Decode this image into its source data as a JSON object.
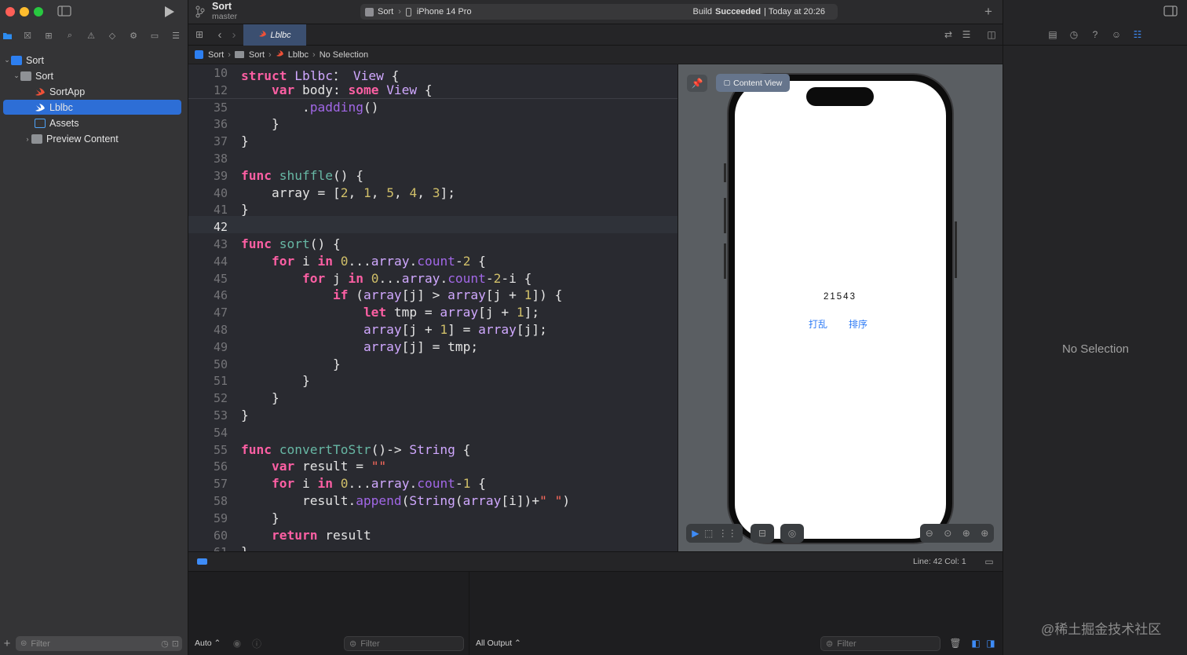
{
  "window": {
    "project_title": "Sort",
    "branch": "master",
    "scheme": "Sort",
    "device": "iPhone 14 Pro",
    "build_status_prefix": "Build",
    "build_status_word": "Succeeded",
    "build_status_suffix": "| Today at 20:26"
  },
  "navigator": {
    "items": [
      {
        "label": "Sort",
        "icon": "project-icon"
      },
      {
        "label": "Sort",
        "icon": "folder-icon"
      },
      {
        "label": "SortApp",
        "icon": "swift-icon"
      },
      {
        "label": "Lblbc",
        "icon": "swift-icon"
      },
      {
        "label": "Assets",
        "icon": "asset-catalog-icon"
      },
      {
        "label": "Preview Content",
        "icon": "folder-icon"
      }
    ],
    "filter_placeholder": "Filter"
  },
  "editor": {
    "active_tab": "Lblbc",
    "breadcrumb": [
      "Sort",
      "Sort",
      "Lblbc",
      "No Selection"
    ],
    "current_line": "42",
    "lines": [
      {
        "n": "10",
        "segs": [
          [
            "kw",
            "struct "
          ],
          [
            "ty",
            "Lblbc"
          ],
          [
            "",
            "："
          ],
          [
            "ty",
            " View"
          ],
          [
            "",
            " {"
          ]
        ]
      },
      {
        "n": "12",
        "segs": [
          [
            "",
            "    "
          ],
          [
            "kw",
            "var "
          ],
          [
            "",
            "body: "
          ],
          [
            "kw",
            "some "
          ],
          [
            "ty",
            "View"
          ],
          [
            "",
            " {"
          ]
        ]
      },
      {
        "n": "35",
        "segs": [
          [
            "",
            "        ."
          ],
          [
            "mt",
            "padding"
          ],
          [
            "",
            "()"
          ]
        ]
      },
      {
        "n": "36",
        "segs": [
          [
            "",
            "    }"
          ]
        ]
      },
      {
        "n": "37",
        "segs": [
          [
            "",
            "}"
          ]
        ]
      },
      {
        "n": "38",
        "segs": [
          [
            "",
            ""
          ]
        ]
      },
      {
        "n": "39",
        "segs": [
          [
            "kw",
            "func "
          ],
          [
            "fn",
            "shuffle"
          ],
          [
            "",
            "() {"
          ]
        ]
      },
      {
        "n": "40",
        "segs": [
          [
            "",
            "    array = ["
          ],
          [
            "nu",
            "2"
          ],
          [
            "",
            ", "
          ],
          [
            "nu",
            "1"
          ],
          [
            "",
            ", "
          ],
          [
            "nu",
            "5"
          ],
          [
            "",
            ", "
          ],
          [
            "nu",
            "4"
          ],
          [
            "",
            ", "
          ],
          [
            "nu",
            "3"
          ],
          [
            "",
            "];"
          ]
        ]
      },
      {
        "n": "41",
        "segs": [
          [
            "",
            "}"
          ]
        ]
      },
      {
        "n": "42",
        "segs": [
          [
            "",
            ""
          ]
        ]
      },
      {
        "n": "43",
        "segs": [
          [
            "kw",
            "func "
          ],
          [
            "fn",
            "sort"
          ],
          [
            "",
            "() {"
          ]
        ]
      },
      {
        "n": "44",
        "segs": [
          [
            "",
            "    "
          ],
          [
            "kw",
            "for "
          ],
          [
            "",
            "i "
          ],
          [
            "kw",
            "in "
          ],
          [
            "nu",
            "0"
          ],
          [
            "",
            "..."
          ],
          [
            "ty",
            "array"
          ],
          [
            "",
            "."
          ],
          [
            "mt",
            "count"
          ],
          [
            "",
            "-"
          ],
          [
            "nu",
            "2"
          ],
          [
            "",
            " {"
          ]
        ]
      },
      {
        "n": "45",
        "segs": [
          [
            "",
            "        "
          ],
          [
            "kw",
            "for "
          ],
          [
            "",
            "j "
          ],
          [
            "kw",
            "in "
          ],
          [
            "nu",
            "0"
          ],
          [
            "",
            "..."
          ],
          [
            "ty",
            "array"
          ],
          [
            "",
            "."
          ],
          [
            "mt",
            "count"
          ],
          [
            "",
            "-"
          ],
          [
            "nu",
            "2"
          ],
          [
            "",
            "-i {"
          ]
        ]
      },
      {
        "n": "46",
        "segs": [
          [
            "",
            "            "
          ],
          [
            "kw",
            "if "
          ],
          [
            "",
            "("
          ],
          [
            "ty",
            "array"
          ],
          [
            "",
            "[j] > "
          ],
          [
            "ty",
            "array"
          ],
          [
            "",
            "[j + "
          ],
          [
            "nu",
            "1"
          ],
          [
            "",
            "]) {"
          ]
        ]
      },
      {
        "n": "47",
        "segs": [
          [
            "",
            "                "
          ],
          [
            "kw",
            "let "
          ],
          [
            "",
            "tmp = "
          ],
          [
            "ty",
            "array"
          ],
          [
            "",
            "[j + "
          ],
          [
            "nu",
            "1"
          ],
          [
            "",
            "];"
          ]
        ]
      },
      {
        "n": "48",
        "segs": [
          [
            "",
            "                "
          ],
          [
            "ty",
            "array"
          ],
          [
            "",
            "[j + "
          ],
          [
            "nu",
            "1"
          ],
          [
            "",
            "] = "
          ],
          [
            "ty",
            "array"
          ],
          [
            "",
            "[j];"
          ]
        ]
      },
      {
        "n": "49",
        "segs": [
          [
            "",
            "                "
          ],
          [
            "ty",
            "array"
          ],
          [
            "",
            "[j] = tmp;"
          ]
        ]
      },
      {
        "n": "50",
        "segs": [
          [
            "",
            "            }"
          ]
        ]
      },
      {
        "n": "51",
        "segs": [
          [
            "",
            "        }"
          ]
        ]
      },
      {
        "n": "52",
        "segs": [
          [
            "",
            "    }"
          ]
        ]
      },
      {
        "n": "53",
        "segs": [
          [
            "",
            "}"
          ]
        ]
      },
      {
        "n": "54",
        "segs": [
          [
            "",
            ""
          ]
        ]
      },
      {
        "n": "55",
        "segs": [
          [
            "kw",
            "func "
          ],
          [
            "fn",
            "convertToStr"
          ],
          [
            "",
            "()-> "
          ],
          [
            "ty",
            "String"
          ],
          [
            "",
            " {"
          ]
        ]
      },
      {
        "n": "56",
        "segs": [
          [
            "",
            "    "
          ],
          [
            "kw",
            "var "
          ],
          [
            "",
            "result = "
          ],
          [
            "st",
            "\"\""
          ]
        ]
      },
      {
        "n": "57",
        "segs": [
          [
            "",
            "    "
          ],
          [
            "kw",
            "for "
          ],
          [
            "",
            "i "
          ],
          [
            "kw",
            "in "
          ],
          [
            "nu",
            "0"
          ],
          [
            "",
            "..."
          ],
          [
            "ty",
            "array"
          ],
          [
            "",
            "."
          ],
          [
            "mt",
            "count"
          ],
          [
            "",
            "-"
          ],
          [
            "nu",
            "1"
          ],
          [
            "",
            " {"
          ]
        ]
      },
      {
        "n": "58",
        "segs": [
          [
            "",
            "        result."
          ],
          [
            "mt",
            "append"
          ],
          [
            "",
            "("
          ],
          [
            "ty",
            "String"
          ],
          [
            "",
            "("
          ],
          [
            "ty",
            "array"
          ],
          [
            "",
            "[i])+"
          ],
          [
            "st",
            "\" \""
          ],
          [
            "",
            ")"
          ]
        ]
      },
      {
        "n": "59",
        "segs": [
          [
            "",
            "    }"
          ]
        ]
      },
      {
        "n": "60",
        "segs": [
          [
            "",
            "    "
          ],
          [
            "kw",
            "return "
          ],
          [
            "",
            "result"
          ]
        ]
      },
      {
        "n": "61",
        "segs": [
          [
            "",
            "}"
          ]
        ]
      }
    ]
  },
  "preview": {
    "label": "Content View",
    "array_text": "21543",
    "shuffle_button": "打乱",
    "sort_button": "排序"
  },
  "inspector": {
    "empty_text": "No Selection"
  },
  "status": {
    "position": "Line: 42  Col: 1"
  },
  "debug": {
    "auto_label": "Auto ⌃",
    "output_label": "All Output ⌃",
    "filter_placeholder": "Filter"
  },
  "watermark": "@稀土掘金技术社区",
  "colors": {
    "accent": "#2d6ed6",
    "keyword": "#fc5fa3",
    "type": "#d0a8ff",
    "number": "#d0bf69",
    "string": "#fc6a5d",
    "function": "#67b7a4"
  }
}
